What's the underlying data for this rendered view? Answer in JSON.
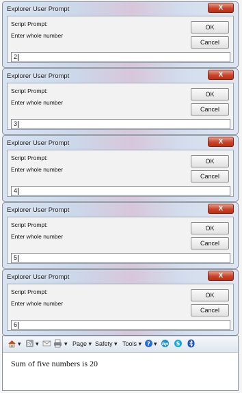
{
  "dialogs": [
    {
      "title": "Explorer User Prompt",
      "close_glyph": "X",
      "label": "Script Prompt:",
      "prompt": "Enter whole number",
      "ok_label": "OK",
      "cancel_label": "Cancel",
      "input_value": "2"
    },
    {
      "title": "Explorer User Prompt",
      "close_glyph": "X",
      "label": "Script Prompt:",
      "prompt": "Enter whole number",
      "ok_label": "OK",
      "cancel_label": "Cancel",
      "input_value": "3"
    },
    {
      "title": "Explorer User Prompt",
      "close_glyph": "X",
      "label": "Script Prompt:",
      "prompt": "Enter whole number",
      "ok_label": "OK",
      "cancel_label": "Cancel",
      "input_value": "4"
    },
    {
      "title": "Explorer User Prompt",
      "close_glyph": "X",
      "label": "Script Prompt:",
      "prompt": "Enter whole number",
      "ok_label": "OK",
      "cancel_label": "Cancel",
      "input_value": "5"
    },
    {
      "title": "Explorer User Prompt",
      "close_glyph": "X",
      "label": "Script Prompt:",
      "prompt": "Enter whole number",
      "ok_label": "OK",
      "cancel_label": "Cancel",
      "input_value": "6"
    }
  ],
  "toolbar": {
    "page_label": "Page ▾",
    "safety_label": "Safety ▾",
    "tools_label": "Tools ▾",
    "dropdown_glyph": "▾",
    "icons": [
      "home-icon",
      "feeds-icon",
      "mail-icon",
      "print-icon",
      "help-icon",
      "hp-icon",
      "skype-icon",
      "bluetooth-icon"
    ]
  },
  "page_content": {
    "text": "Sum of five numbers is 20"
  },
  "colors": {
    "close_button": "#c9432a",
    "title_gradient_accent": "#d8c6da",
    "dialog_body": "#f2f2f2"
  }
}
